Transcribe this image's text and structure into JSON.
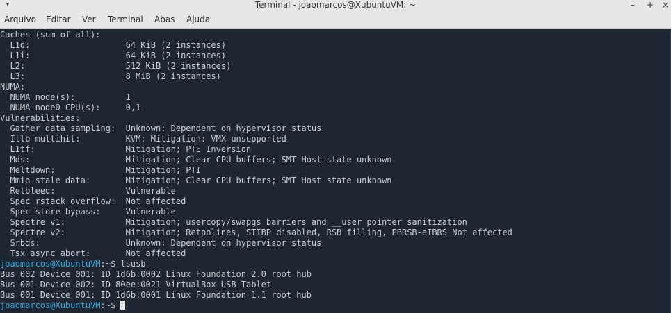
{
  "window": {
    "title": "Terminal - joaomarcos@XubuntuVM: ~",
    "controls": {
      "menu": "▾",
      "minimize": "–",
      "maximize": "+",
      "close": "×"
    }
  },
  "menubar": {
    "items": [
      "Arquivo",
      "Editar",
      "Ver",
      "Terminal",
      "Abas",
      "Ajuda"
    ]
  },
  "terminal": {
    "lines": [
      "Caches (sum of all):",
      "  L1d:                   64 KiB (2 instances)",
      "  L1i:                   64 KiB (2 instances)",
      "  L2:                    512 KiB (2 instances)",
      "  L3:                    8 MiB (2 instances)",
      "NUMA:",
      "  NUMA node(s):          1",
      "  NUMA node0 CPU(s):     0,1",
      "Vulnerabilities:",
      "  Gather data sampling:  Unknown: Dependent on hypervisor status",
      "  Itlb multihit:         KVM: Mitigation: VMX unsupported",
      "  L1tf:                  Mitigation; PTE Inversion",
      "  Mds:                   Mitigation; Clear CPU buffers; SMT Host state unknown",
      "  Meltdown:              Mitigation; PTI",
      "  Mmio stale data:       Mitigation; Clear CPU buffers; SMT Host state unknown",
      "  Retbleed:              Vulnerable",
      "  Spec rstack overflow:  Not affected",
      "  Spec store bypass:     Vulnerable",
      "  Spectre v1:            Mitigation; usercopy/swapgs barriers and __user pointer sanitization",
      "  Spectre v2:            Mitigation; Retpolines, STIBP disabled, RSB filling, PBRSB-eIBRS Not affected",
      "  Srbds:                 Unknown: Dependent on hypervisor status",
      "  Tsx async abort:       Not affected"
    ],
    "prompt": {
      "user_host": "joaomarcos@XubuntuVM",
      "path": ":~$ "
    },
    "command": "lsusb",
    "command_output": [
      "Bus 002 Device 001: ID 1d6b:0002 Linux Foundation 2.0 root hub",
      "Bus 001 Device 002: ID 80ee:0021 VirtualBox USB Tablet",
      "Bus 001 Device 001: ID 1d6b:0001 Linux Foundation 1.1 root hub"
    ],
    "colors": {
      "background": "#1e2631",
      "foreground": "#c8ccd1",
      "prompt_user": "#2ea9df"
    }
  }
}
